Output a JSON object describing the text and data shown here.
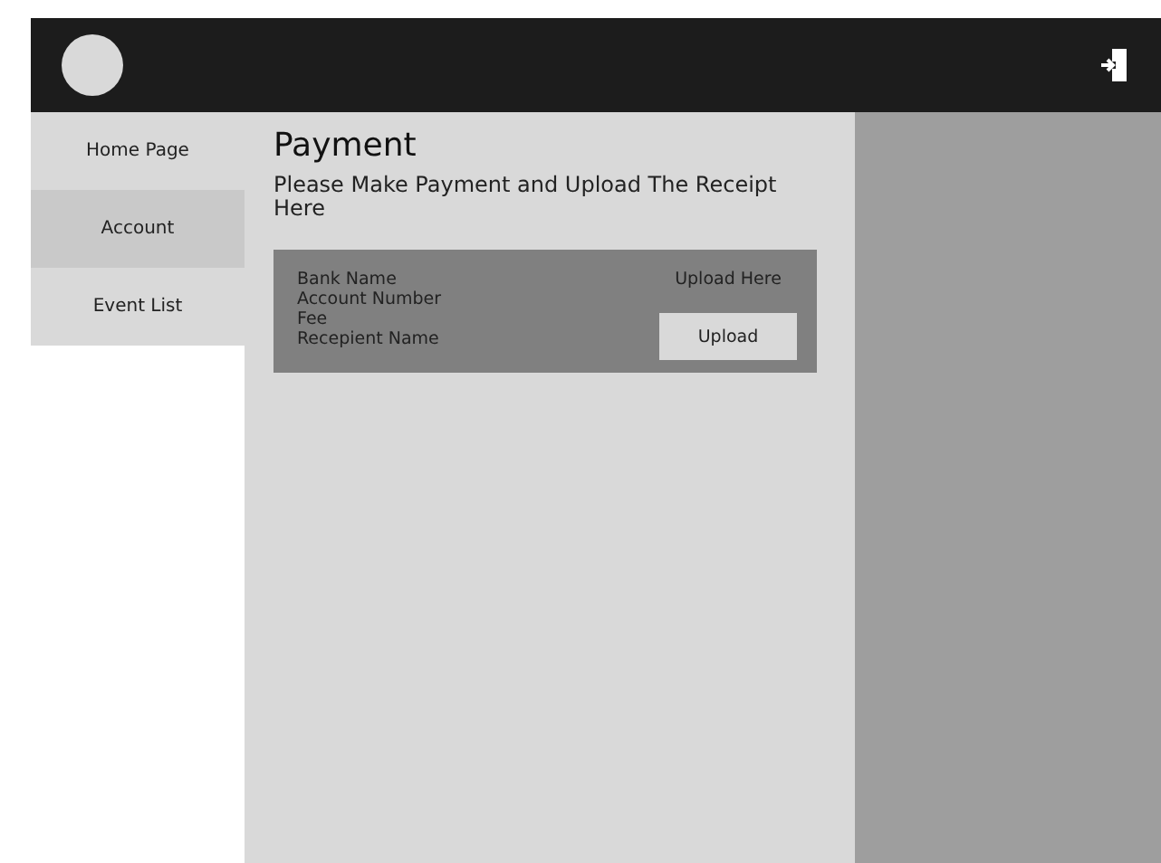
{
  "sidebar": {
    "items": [
      {
        "label": "Home Page",
        "selected": false
      },
      {
        "label": "Account",
        "selected": true
      },
      {
        "label": "Event List",
        "selected": false
      }
    ]
  },
  "main": {
    "title": "Payment",
    "instruction": "Please Make Payment and Upload The Receipt Here",
    "payment_card": {
      "fields": [
        "Bank Name",
        "Account Number",
        "Fee",
        "Recepient Name"
      ],
      "upload_label": "Upload Here",
      "upload_button": "Upload"
    }
  }
}
